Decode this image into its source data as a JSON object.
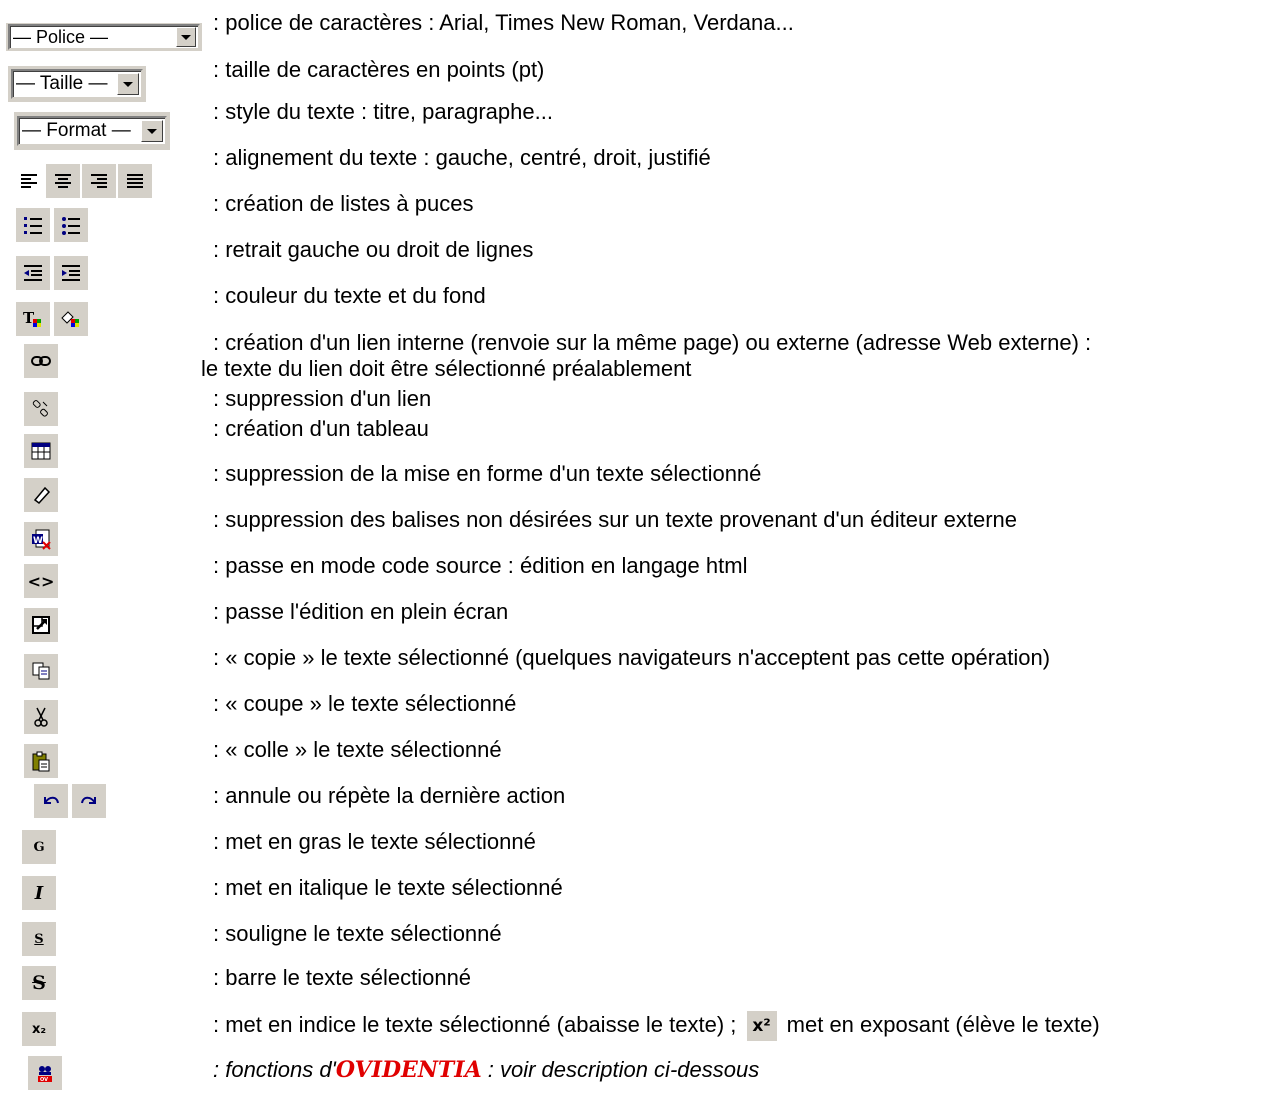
{
  "selects": {
    "font": "— Police —",
    "size": "— Taille —",
    "format": "— Format —"
  },
  "rows": [
    {
      "desc": ": police de caractères : Arial, Times New Roman, Verdana..."
    },
    {
      "desc": ": taille de caractères en points (pt)"
    },
    {
      "desc": ": style du texte : titre, paragraphe..."
    },
    {
      "desc": ": alignement du texte : gauche, centré, droit, justifié"
    },
    {
      "desc": ": création de listes à puces"
    },
    {
      "desc": ": retrait gauche ou droit de lignes"
    },
    {
      "desc": ": couleur du texte et du fond"
    },
    {
      "desc": ": création d'un lien interne (renvoie sur la même page) ou externe (adresse Web externe) :"
    },
    {
      "desc": "le texte du lien doit être sélectionné préalablement"
    },
    {
      "desc": ": suppression d'un lien"
    },
    {
      "desc": ": création d'un tableau"
    },
    {
      "desc": ": suppression de la mise en forme d'un texte sélectionné"
    },
    {
      "desc": ": suppression des balises non désirées sur un texte provenant d'un éditeur externe"
    },
    {
      "desc": ": passe en mode code source : édition en langage html"
    },
    {
      "desc": ": passe l'édition en plein écran"
    },
    {
      "desc": ": « copie » le texte sélectionné (quelques navigateurs n'acceptent pas cette opération)"
    },
    {
      "desc": ": « coupe » le texte sélectionné"
    },
    {
      "desc": ": « colle » le texte sélectionné"
    },
    {
      "desc": ": annule ou répète la dernière action"
    },
    {
      "desc": ": met en gras le texte sélectionné"
    },
    {
      "desc": ": met en italique le texte sélectionné"
    },
    {
      "desc": ": souligne le texte sélectionné"
    },
    {
      "desc": ": barre le texte sélectionné"
    },
    {
      "desc_a": ": met en indice le texte sélectionné (abaisse le texte) ;",
      "desc_b": " met en exposant (élève le texte)"
    },
    {
      "desc_a": ": fonctions d'",
      "brand": "OVIDENTIA",
      "desc_b": " : voir description ci-dessous"
    }
  ],
  "icons": {
    "bold": "G",
    "italic": "I",
    "underline": "S",
    "strike": "S",
    "subscript": "x₂",
    "superscript": "x²",
    "code": "<>"
  },
  "colors": {
    "toolbar_bg": "#d4d0c8",
    "brand": "#e00000"
  }
}
